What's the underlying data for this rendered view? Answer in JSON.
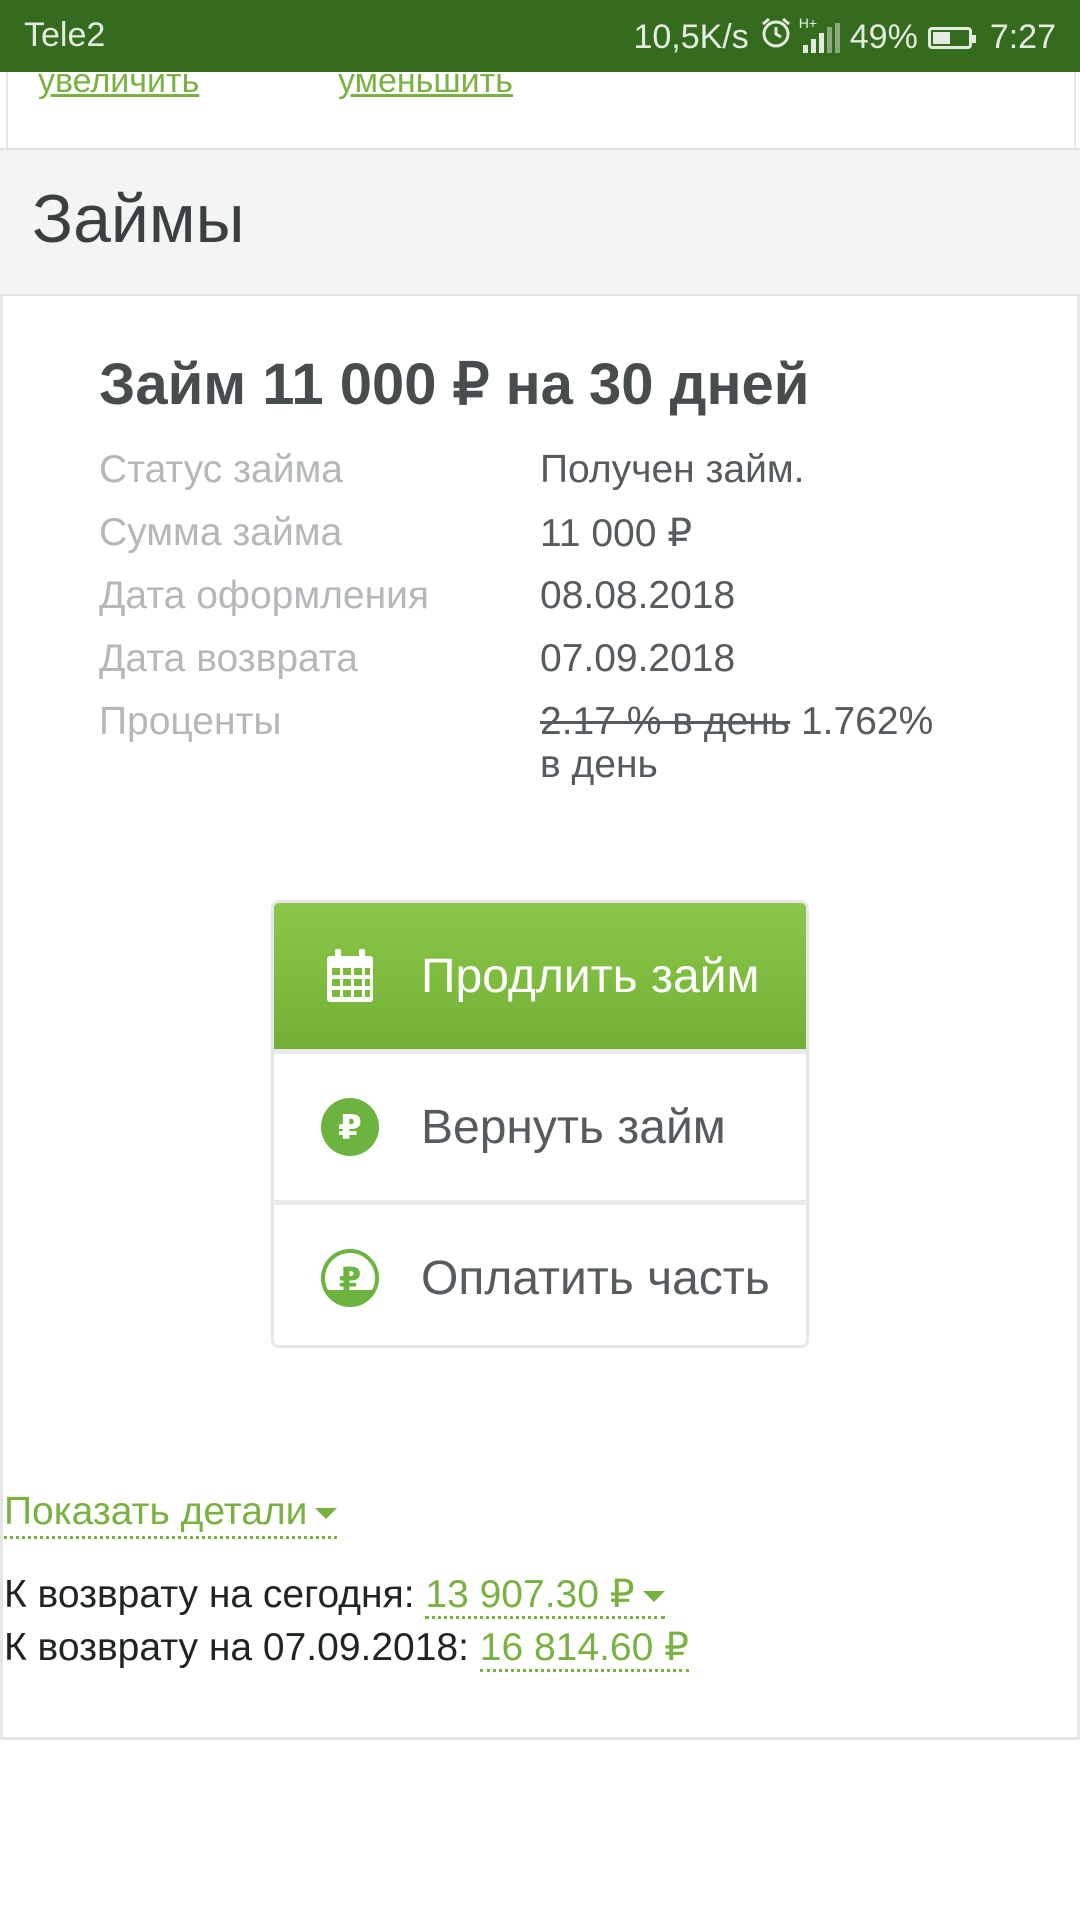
{
  "status_bar": {
    "carrier": "Tele2",
    "speed": "10,5K/s",
    "network": "H+",
    "battery": "49%",
    "battery_level": 0.49,
    "time": "7:27",
    "bar_color": "#346b1e"
  },
  "top_links": {
    "increase": "увеличить",
    "decrease": "уменьшить"
  },
  "section": {
    "title": "Займы"
  },
  "loan": {
    "title": "Займ 11 000 ₽ на 30 дней",
    "fields": [
      {
        "label": "Статус займа",
        "value": "Получен займ."
      },
      {
        "label": "Сумма займа",
        "value": "11 000 ₽"
      },
      {
        "label": "Дата оформления",
        "value": "08.08.2018"
      },
      {
        "label": "Дата возврата",
        "value": "07.09.2018"
      }
    ],
    "interest": {
      "label": "Проценты",
      "old_rate": "2.17 % в день",
      "new_rate": "1.762%",
      "new_rate_suffix": "в день"
    }
  },
  "actions": {
    "extend": {
      "label": "Продлить займ",
      "icon": "calendar-icon"
    },
    "repay": {
      "label": "Вернуть займ",
      "icon": "ruble-coin-icon"
    },
    "partial": {
      "label": "Оплатить часть",
      "icon": "ruble-coin-partial-icon"
    }
  },
  "details": {
    "show_label": "Показать детали",
    "due_today_label": "К возврату на сегодня:",
    "due_today_amount": "13 907.30 ₽",
    "due_date_label": "К возврату на 07.09.2018:",
    "due_date_amount": "16 814.60 ₽"
  },
  "colors": {
    "accent": "#7ab241",
    "primary_button": "#7ab93a"
  }
}
